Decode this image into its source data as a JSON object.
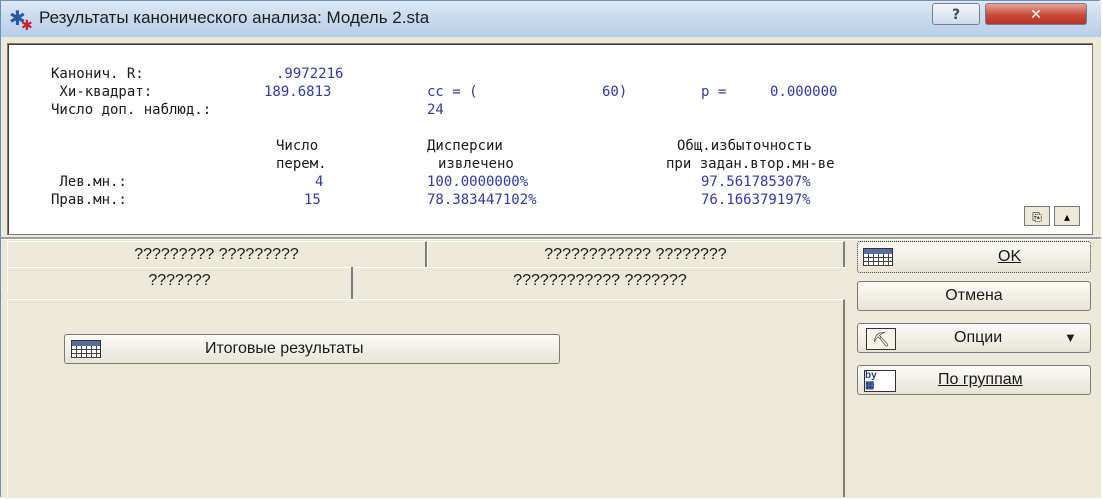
{
  "window": {
    "title": "Результаты канонического анализа: Модель 2.sta",
    "help_label": "?",
    "close_label": "✕"
  },
  "results": {
    "line1_label": "Канонич. R:",
    "canonical_r": ".9972216",
    "line2_label": " Хи-квадрат:",
    "chi_square": "189.6813",
    "df_label": "cc = (",
    "df_value": "60)",
    "p_label": "p =",
    "p_value": "0.000000",
    "line3_label": "Число доп. наблюд.:",
    "valid_n": "24",
    "headers": {
      "col1_line1": "Число",
      "col1_line2": "перем.",
      "col2_line1": "Дисперсии",
      "col2_line2": "извлечено",
      "col3_line1": "Общ.избыточность",
      "col3_line2": "при задан.втор.мн-ве"
    },
    "rows": [
      {
        "label": " Лев.мн.:",
        "n_vars": "4",
        "variance": "100.0000000%",
        "redundancy": "97.561785307%"
      },
      {
        "label": "Прав.мн.:",
        "n_vars": "15",
        "variance": "78.383447102%",
        "redundancy": "76.166379197%"
      }
    ]
  },
  "tabs": {
    "back_row": [
      "????????? ?????????",
      "???????????? ????????"
    ],
    "front_row": [
      "???????",
      "???????????? ???????"
    ]
  },
  "panel": {
    "summary_button": "Итоговые результаты"
  },
  "side_buttons": {
    "ok": "OK",
    "cancel": "Отмена",
    "options": "Опции",
    "by_groups": "По группам"
  }
}
